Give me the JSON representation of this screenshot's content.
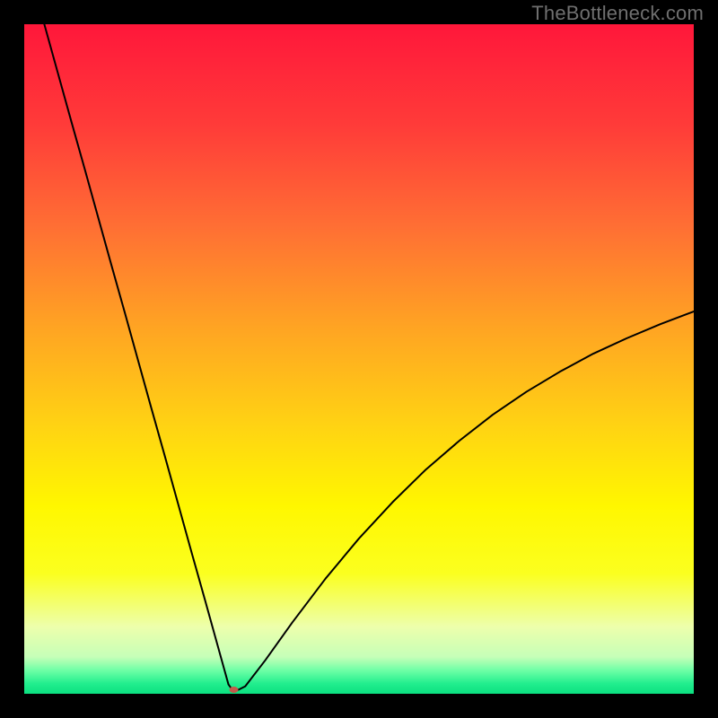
{
  "watermark": "TheBottleneck.com",
  "chart_data": {
    "type": "line",
    "title": "",
    "xlabel": "",
    "ylabel": "",
    "xlim": [
      0,
      100
    ],
    "ylim": [
      0,
      100
    ],
    "gradient_stops": [
      {
        "offset": 0.0,
        "color": "#ff173a"
      },
      {
        "offset": 0.15,
        "color": "#ff3b39"
      },
      {
        "offset": 0.3,
        "color": "#ff6e34"
      },
      {
        "offset": 0.45,
        "color": "#ffa323"
      },
      {
        "offset": 0.6,
        "color": "#ffd313"
      },
      {
        "offset": 0.72,
        "color": "#fff700"
      },
      {
        "offset": 0.82,
        "color": "#fbff1f"
      },
      {
        "offset": 0.9,
        "color": "#edffac"
      },
      {
        "offset": 0.945,
        "color": "#c6ffb8"
      },
      {
        "offset": 0.965,
        "color": "#6effa6"
      },
      {
        "offset": 0.985,
        "color": "#21ee8e"
      },
      {
        "offset": 1.0,
        "color": "#0be080"
      }
    ],
    "series": [
      {
        "name": "bottleneck-curve",
        "x": [
          3,
          5,
          7,
          9,
          11,
          13,
          15,
          17,
          19,
          21,
          23,
          25,
          27,
          29,
          30.5,
          31,
          31.3,
          31.6,
          32,
          33,
          36,
          40,
          45,
          50,
          55,
          60,
          65,
          70,
          75,
          80,
          85,
          90,
          95,
          100
        ],
        "y": [
          100,
          92.8,
          85.6,
          78.5,
          71.3,
          64.1,
          57.0,
          49.8,
          42.6,
          35.5,
          28.3,
          21.1,
          14.0,
          6.8,
          1.4,
          0.7,
          0.6,
          0.6,
          0.6,
          1.1,
          5.0,
          10.6,
          17.2,
          23.2,
          28.6,
          33.5,
          37.8,
          41.7,
          45.1,
          48.1,
          50.8,
          53.1,
          55.2,
          57.1
        ]
      }
    ],
    "marker": {
      "x": 31.3,
      "y": 0.6,
      "color": "#c4594b",
      "rx": 5,
      "ry": 3.5
    }
  }
}
